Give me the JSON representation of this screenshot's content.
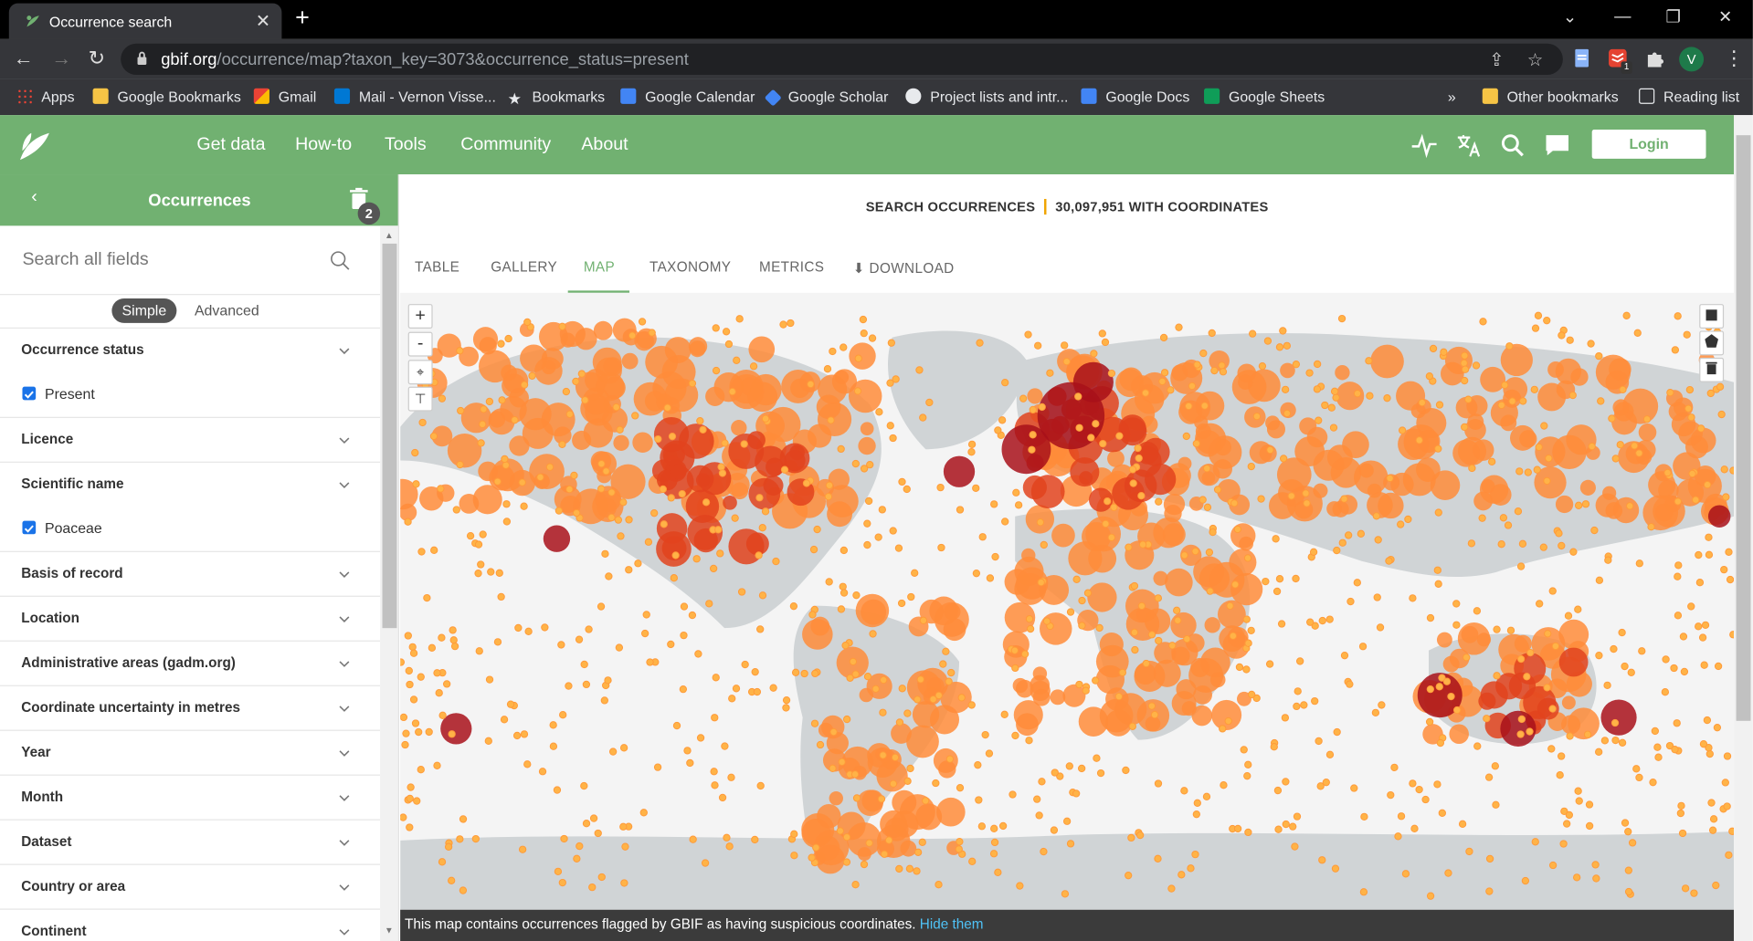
{
  "browser": {
    "tab_title": "Occurrence search",
    "url_host": "gbif.org",
    "url_path": "/occurrence/map?taxon_key=3073&occurrence_status=present",
    "bookmarks": [
      "Apps",
      "Google Bookmarks",
      "Gmail",
      "Mail - Vernon Visse...",
      "Bookmarks",
      "Google Calendar",
      "Google Scholar",
      "Project lists and intr...",
      "Google Docs",
      "Google Sheets"
    ],
    "more_bookmarks": "»",
    "other_bookmarks": "Other bookmarks",
    "reading_list": "Reading list",
    "profile_initial": "V",
    "extension_badge": "1"
  },
  "header": {
    "nav": [
      "Get data",
      "How-to",
      "Tools",
      "Community",
      "About"
    ],
    "login": "Login"
  },
  "sidebar": {
    "title": "Occurrences",
    "filter_count": "2",
    "search_placeholder": "Search all fields",
    "mode_simple": "Simple",
    "mode_advanced": "Advanced",
    "filters": [
      {
        "label": "Occurrence status",
        "checked": "Present"
      },
      {
        "label": "Licence"
      },
      {
        "label": "Scientific name",
        "checked": "Poaceae"
      },
      {
        "label": "Basis of record"
      },
      {
        "label": "Location"
      },
      {
        "label": "Administrative areas (gadm.org)"
      },
      {
        "label": "Coordinate uncertainty in metres"
      },
      {
        "label": "Year"
      },
      {
        "label": "Month"
      },
      {
        "label": "Dataset"
      },
      {
        "label": "Country or area"
      },
      {
        "label": "Continent"
      }
    ]
  },
  "main": {
    "summary_label": "SEARCH OCCURRENCES",
    "summary_count": "30,097,951 WITH COORDINATES",
    "tabs": [
      "TABLE",
      "GALLERY",
      "MAP",
      "TAXONOMY",
      "METRICS",
      "DOWNLOAD"
    ],
    "active_tab": "MAP",
    "map_controls": {
      "zoom_in": "+",
      "zoom_out": "-"
    },
    "note_text": "This map contains occurrences flagged by GBIF as having suspicious coordinates.",
    "note_link": "Hide them"
  },
  "colors": {
    "brand_green": "#71b171",
    "density_low": "#ffb347",
    "density_mid": "#ff8c3a",
    "density_high": "#e2431d",
    "density_max": "#a8101a",
    "land": "#d0d4d6",
    "ocean": "#f4f4f4"
  }
}
